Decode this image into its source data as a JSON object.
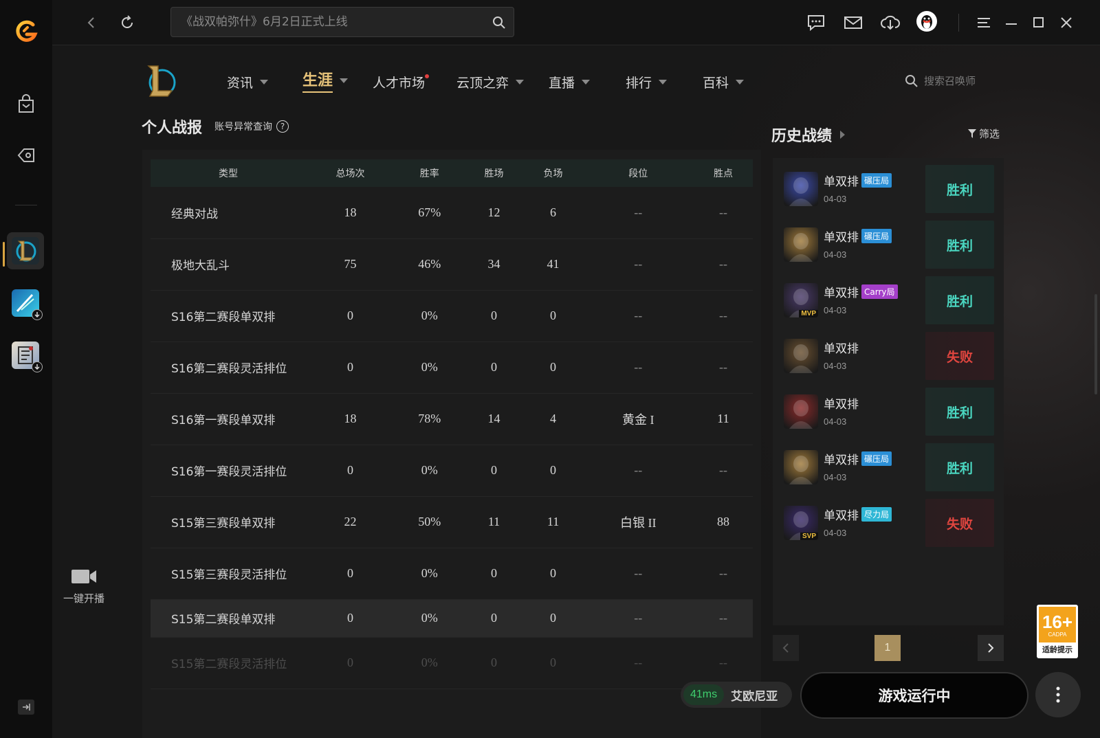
{
  "topbar": {
    "search_placeholder": "《战双帕弥什》6月2日正式上线"
  },
  "nav": {
    "items": [
      {
        "label": "资讯",
        "active": false,
        "has_caret": true,
        "has_dot": false
      },
      {
        "label": "生涯",
        "active": true,
        "has_caret": true,
        "has_dot": false
      },
      {
        "label": "人才市场",
        "active": false,
        "has_caret": false,
        "has_dot": true
      },
      {
        "label": "云顶之弈",
        "active": false,
        "has_caret": true,
        "has_dot": false
      },
      {
        "label": "直播",
        "active": false,
        "has_caret": true,
        "has_dot": false
      },
      {
        "label": "排行",
        "active": false,
        "has_caret": true,
        "has_dot": false
      },
      {
        "label": "百科",
        "active": false,
        "has_caret": true,
        "has_dot": false
      }
    ],
    "summoner_search_placeholder": "搜索召唤师"
  },
  "stats": {
    "title": "个人战报",
    "account_check": "账号异常查询",
    "help_icon": "?",
    "columns": [
      "类型",
      "总场次",
      "胜率",
      "胜场",
      "负场",
      "段位",
      "胜点"
    ],
    "rows": [
      [
        "经典对战",
        "18",
        "67%",
        "12",
        "6",
        "--",
        "--"
      ],
      [
        "极地大乱斗",
        "75",
        "46%",
        "34",
        "41",
        "--",
        "--"
      ],
      [
        "S16第二赛段单双排",
        "0",
        "0%",
        "0",
        "0",
        "--",
        "--"
      ],
      [
        "S16第二赛段灵活排位",
        "0",
        "0%",
        "0",
        "0",
        "--",
        "--"
      ],
      [
        "S16第一赛段单双排",
        "18",
        "78%",
        "14",
        "4",
        "黄金 I",
        "11"
      ],
      [
        "S16第一赛段灵活排位",
        "0",
        "0%",
        "0",
        "0",
        "--",
        "--"
      ],
      [
        "S15第三赛段单双排",
        "22",
        "50%",
        "11",
        "11",
        "白银 II",
        "88"
      ],
      [
        "S15第三赛段灵活排位",
        "0",
        "0%",
        "0",
        "0",
        "--",
        "--"
      ],
      [
        "S15第二赛段单双排",
        "0",
        "0%",
        "0",
        "0",
        "--",
        "--"
      ],
      [
        "S15第二赛段灵活排位",
        "0",
        "0%",
        "0",
        "0",
        "--",
        "--"
      ]
    ]
  },
  "history": {
    "title": "历史战绩",
    "filter_label": "筛选",
    "items": [
      {
        "mode": "单双排",
        "tag": "碾压局",
        "tag_color": "#2b8fd6",
        "date": "04-03",
        "result": "胜利",
        "win": true,
        "champ_color": "#3b4aa8",
        "mvp": ""
      },
      {
        "mode": "单双排",
        "tag": "碾压局",
        "tag_color": "#2b8fd6",
        "date": "04-03",
        "result": "胜利",
        "win": true,
        "champ_color": "#a07a3a",
        "mvp": ""
      },
      {
        "mode": "单双排",
        "tag": "Carry局",
        "tag_color": "#a43fc9",
        "date": "04-03",
        "result": "胜利",
        "win": true,
        "champ_color": "#4a3a6a",
        "mvp": "MVP"
      },
      {
        "mode": "单双排",
        "tag": "",
        "tag_color": "",
        "date": "04-03",
        "result": "失败",
        "win": false,
        "champ_color": "#6a5030",
        "mvp": ""
      },
      {
        "mode": "单双排",
        "tag": "",
        "tag_color": "",
        "date": "04-03",
        "result": "胜利",
        "win": true,
        "champ_color": "#8a2a2a",
        "mvp": ""
      },
      {
        "mode": "单双排",
        "tag": "碾压局",
        "tag_color": "#2b8fd6",
        "date": "04-03",
        "result": "胜利",
        "win": true,
        "champ_color": "#a07a3a",
        "mvp": ""
      },
      {
        "mode": "单双排",
        "tag": "尽力局",
        "tag_color": "#2fb7d6",
        "date": "04-03",
        "result": "失败",
        "win": false,
        "champ_color": "#3a2a6a",
        "mvp": "SVP"
      }
    ],
    "page": "1"
  },
  "bottom": {
    "live_label": "一键开播",
    "ping": "41ms",
    "server": "艾欧尼亚",
    "play_label": "游戏运行中"
  },
  "age_badge": {
    "age": "16+",
    "org": "CADPA",
    "text": "适龄提示"
  },
  "colors": {
    "accent_gold": "#e8c47a",
    "win": "#4ad6c0",
    "loss": "#e0453f"
  }
}
